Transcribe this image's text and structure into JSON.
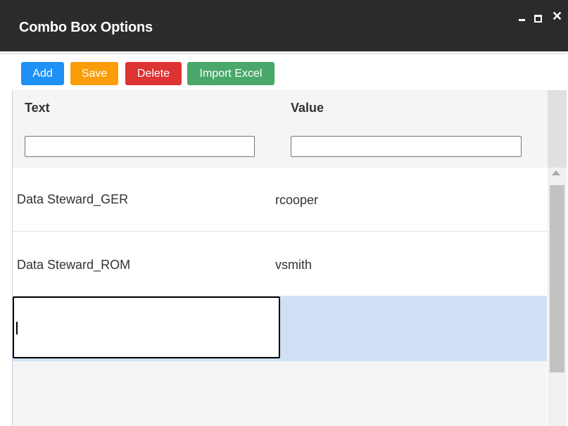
{
  "window": {
    "title": "Combo Box Options",
    "controls": {
      "minimize": "minimize",
      "maximize": "maximize",
      "close": "✕"
    }
  },
  "toolbar": {
    "add_label": "Add",
    "save_label": "Save",
    "delete_label": "Delete",
    "import_label": "Import Excel"
  },
  "grid": {
    "columns": [
      "Text",
      "Value"
    ],
    "filters": {
      "text": "",
      "value": ""
    },
    "rows": [
      {
        "text": "Data Steward_GER",
        "value": "rcooper"
      },
      {
        "text": "Data Steward_ROM",
        "value": "vsmith"
      }
    ],
    "edit_row": {
      "text": "",
      "value": ""
    }
  },
  "colors": {
    "titlebar": "#2b2b2b",
    "add": "#1e90f6",
    "save": "#fb9d09",
    "delete": "#dd3333",
    "import": "#4aa86a",
    "selected_row": "#cfe0f5"
  },
  "icons": [
    "minimize-icon",
    "maximize-icon",
    "close-icon",
    "scroll-up-arrow-icon"
  ]
}
